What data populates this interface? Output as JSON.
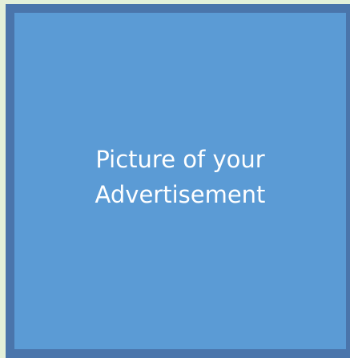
{
  "advertisement": {
    "text_line_1": "Picture of your",
    "text_line_2": "Advertisement"
  },
  "colors": {
    "page_background": "#e3f0d9",
    "frame_border": "#4a75ab",
    "frame_fill": "#5b9bd5",
    "text": "#ffffff"
  }
}
